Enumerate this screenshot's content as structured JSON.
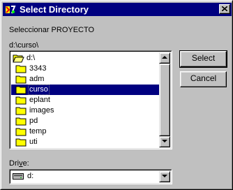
{
  "window": {
    "title": "Select Directory",
    "colors": {
      "titlebar": "#000080",
      "face": "#c0c0c0",
      "selection": "#000080"
    }
  },
  "prompt": "Seleccionar PROYECTO",
  "current_path": "d:\\curso\\",
  "directory_tree": {
    "items": [
      {
        "label": "d:\\",
        "icon": "open-folder-icon",
        "selected": false
      },
      {
        "label": "3343",
        "icon": "folder-icon",
        "selected": false
      },
      {
        "label": "adm",
        "icon": "folder-icon",
        "selected": false
      },
      {
        "label": "curso",
        "icon": "folder-icon",
        "selected": true
      },
      {
        "label": "eplant",
        "icon": "folder-icon",
        "selected": false
      },
      {
        "label": "images",
        "icon": "folder-icon",
        "selected": false
      },
      {
        "label": "pd",
        "icon": "folder-icon",
        "selected": false
      },
      {
        "label": "temp",
        "icon": "folder-icon",
        "selected": false
      },
      {
        "label": "uti",
        "icon": "folder-icon",
        "selected": false
      }
    ]
  },
  "buttons": {
    "select": "Select",
    "cancel": "Cancel"
  },
  "drive": {
    "label_prefix": "Dri",
    "label_accel": "v",
    "label_suffix": "e:",
    "value": "d:"
  }
}
